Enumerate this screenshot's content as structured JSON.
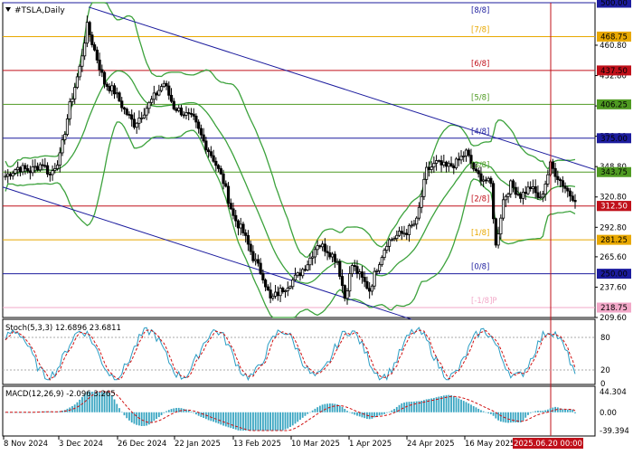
{
  "chart_title": "#TSLA,Daily",
  "x_axis_labels": [
    "8 Nov 2024",
    "3 Dec 2024",
    "26 Dec 2024",
    "22 Jan 2025",
    "13 Feb 2025",
    "10 Mar 2025",
    "1 Apr 2025",
    "24 Apr 2025",
    "16 May 2025"
  ],
  "x_cursor_label": "2025.06.20 00:00",
  "price_axis": {
    "ticks": [
      460.8,
      432.8,
      404.8,
      376.8,
      348.8,
      320.8,
      292.8,
      265.6,
      237.6,
      209.6
    ],
    "current_price": "312.50"
  },
  "murrey_levels": [
    {
      "label": "[8/8]",
      "price": 500.0,
      "color": "#1c1c9e",
      "tag": "500.00"
    },
    {
      "label": "[7/8]",
      "price": 468.75,
      "color": "#e8a800",
      "tag": "468.75"
    },
    {
      "label": "[6/8]",
      "price": 437.5,
      "color": "#c0101a",
      "tag": "437.50"
    },
    {
      "label": "[5/8]",
      "price": 406.25,
      "color": "#4f9a22",
      "tag": "406.25"
    },
    {
      "label": "[4/8]",
      "price": 375.0,
      "color": "#1c1c9e",
      "tag": "375.00"
    },
    {
      "label": "[3/8]",
      "price": 343.75,
      "color": "#4f9a22",
      "tag": "343.75"
    },
    {
      "label": "[2/8]",
      "price": 312.5,
      "color": "#c0101a",
      "tag": "312.50"
    },
    {
      "label": "[1/8]",
      "price": 281.25,
      "color": "#e8a800",
      "tag": "281.25"
    },
    {
      "label": "[0/8]",
      "price": 250.0,
      "color": "#1c1c9e",
      "tag": "250.00"
    },
    {
      "label": "[-1/8]P",
      "price": 218.75,
      "color": "#f2a8c8",
      "tag": "218.75"
    }
  ],
  "stochastic": {
    "label": "Stoch(5,3,3) 12.6896 23.6811",
    "levels": [
      "80",
      "20",
      "0"
    ]
  },
  "macd": {
    "label": "MACD(12,26,9) -2.096 3.265",
    "ticks": [
      "44.304",
      "0.00",
      "-39.394"
    ]
  },
  "chart_data": {
    "type": "candlestick",
    "symbol": "#TSLA",
    "timeframe": "Daily",
    "x_range": [
      "2024-11-08",
      "2025-06-20"
    ],
    "y_range": [
      209.6,
      500.0
    ],
    "price_waypoints": [
      [
        0,
        340
      ],
      [
        5,
        348
      ],
      [
        10,
        345
      ],
      [
        15,
        352
      ],
      [
        18,
        341
      ],
      [
        22,
        358
      ],
      [
        26,
        405
      ],
      [
        30,
        440
      ],
      [
        33,
        478
      ],
      [
        36,
        456
      ],
      [
        40,
        426
      ],
      [
        44,
        418
      ],
      [
        48,
        401
      ],
      [
        52,
        388
      ],
      [
        56,
        400
      ],
      [
        60,
        413
      ],
      [
        64,
        426
      ],
      [
        68,
        404
      ],
      [
        72,
        398
      ],
      [
        76,
        392
      ],
      [
        80,
        372
      ],
      [
        84,
        356
      ],
      [
        88,
        335
      ],
      [
        92,
        303
      ],
      [
        96,
        288
      ],
      [
        100,
        265
      ],
      [
        104,
        248
      ],
      [
        107,
        226
      ],
      [
        110,
        232
      ],
      [
        114,
        240
      ],
      [
        118,
        248
      ],
      [
        122,
        260
      ],
      [
        126,
        278
      ],
      [
        130,
        272
      ],
      [
        134,
        262
      ],
      [
        137,
        228
      ],
      [
        140,
        258
      ],
      [
        144,
        245
      ],
      [
        147,
        235
      ],
      [
        150,
        256
      ],
      [
        154,
        279
      ],
      [
        158,
        285
      ],
      [
        162,
        289
      ],
      [
        166,
        298
      ],
      [
        170,
        345
      ],
      [
        174,
        352
      ],
      [
        178,
        348
      ],
      [
        182,
        352
      ],
      [
        186,
        362
      ],
      [
        190,
        342
      ],
      [
        194,
        336
      ],
      [
        196,
        332
      ],
      [
        198,
        275
      ],
      [
        201,
        318
      ],
      [
        204,
        332
      ],
      [
        208,
        322
      ],
      [
        212,
        330
      ],
      [
        216,
        318
      ],
      [
        220,
        350
      ],
      [
        224,
        336
      ],
      [
        228,
        323
      ],
      [
        230,
        320
      ]
    ],
    "channel_upper_price": [
      [
        0,
        496
      ],
      [
        230,
        346
      ]
    ],
    "channel_lower_price": [
      [
        0,
        330
      ],
      [
        150,
        208
      ]
    ],
    "stoch_oscillation": [
      [
        0,
        2
      ],
      [
        230,
        44
      ]
    ],
    "stoch_current": {
      "k": 12.6896,
      "d": 23.6811
    },
    "macd_current": {
      "macd": -2.096,
      "signal": 3.265
    },
    "macd_range": [
      -39.394,
      44.304
    ]
  }
}
